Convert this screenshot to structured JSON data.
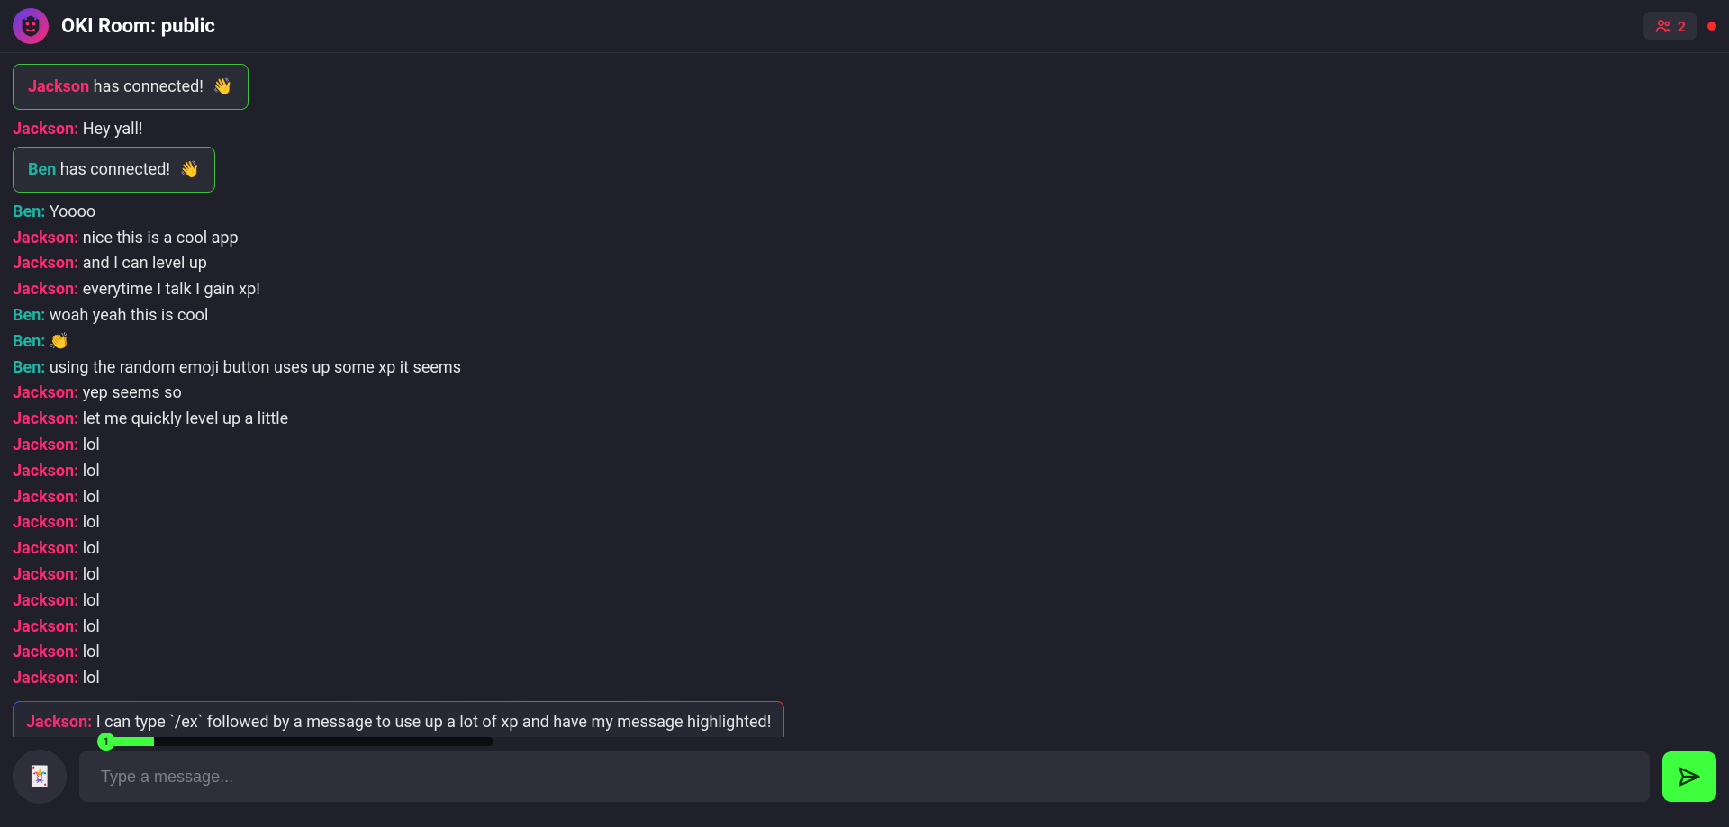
{
  "header": {
    "title": "OKI Room: public",
    "user_count": "2"
  },
  "messages": [
    {
      "type": "connect",
      "user": "Jackson",
      "user_class": "user-jackson",
      "text": "has connected!",
      "emoji": "👋"
    },
    {
      "type": "msg",
      "user": "Jackson",
      "user_class": "user-jackson",
      "text": "Hey yall!"
    },
    {
      "type": "connect",
      "user": "Ben",
      "user_class": "user-ben",
      "text": "has connected!",
      "emoji": "👋"
    },
    {
      "type": "msg",
      "user": "Ben",
      "user_class": "user-ben",
      "text": "Yoooo"
    },
    {
      "type": "msg",
      "user": "Jackson",
      "user_class": "user-jackson",
      "text": "nice this is a cool app"
    },
    {
      "type": "msg",
      "user": "Jackson",
      "user_class": "user-jackson",
      "text": "and I can level up"
    },
    {
      "type": "msg",
      "user": "Jackson",
      "user_class": "user-jackson",
      "text": "everytime I talk I gain xp!"
    },
    {
      "type": "msg",
      "user": "Ben",
      "user_class": "user-ben",
      "text": "woah yeah this is cool"
    },
    {
      "type": "msg",
      "user": "Ben",
      "user_class": "user-ben",
      "text": "👏"
    },
    {
      "type": "msg",
      "user": "Ben",
      "user_class": "user-ben",
      "text": "using the random emoji button uses up some xp it seems"
    },
    {
      "type": "msg",
      "user": "Jackson",
      "user_class": "user-jackson",
      "text": "yep seems so"
    },
    {
      "type": "msg",
      "user": "Jackson",
      "user_class": "user-jackson",
      "text": "let me quickly level up a little"
    },
    {
      "type": "msg",
      "user": "Jackson",
      "user_class": "user-jackson",
      "text": "lol"
    },
    {
      "type": "msg",
      "user": "Jackson",
      "user_class": "user-jackson",
      "text": "lol"
    },
    {
      "type": "msg",
      "user": "Jackson",
      "user_class": "user-jackson",
      "text": "lol"
    },
    {
      "type": "msg",
      "user": "Jackson",
      "user_class": "user-jackson",
      "text": "lol"
    },
    {
      "type": "msg",
      "user": "Jackson",
      "user_class": "user-jackson",
      "text": "lol"
    },
    {
      "type": "msg",
      "user": "Jackson",
      "user_class": "user-jackson",
      "text": "lol"
    },
    {
      "type": "msg",
      "user": "Jackson",
      "user_class": "user-jackson",
      "text": "lol"
    },
    {
      "type": "msg",
      "user": "Jackson",
      "user_class": "user-jackson",
      "text": "lol"
    },
    {
      "type": "msg",
      "user": "Jackson",
      "user_class": "user-jackson",
      "text": "lol"
    },
    {
      "type": "msg",
      "user": "Jackson",
      "user_class": "user-jackson",
      "text": "lol"
    },
    {
      "type": "highlight",
      "user": "Jackson",
      "user_class": "user-jackson",
      "text": "I can type `/ex` followed by a message to use up a lot of xp and have my message highlighted!"
    }
  ],
  "footer": {
    "emoji_icon": "🃏",
    "level": "1",
    "xp_fill_percent": 12,
    "placeholder": "Type a message..."
  }
}
